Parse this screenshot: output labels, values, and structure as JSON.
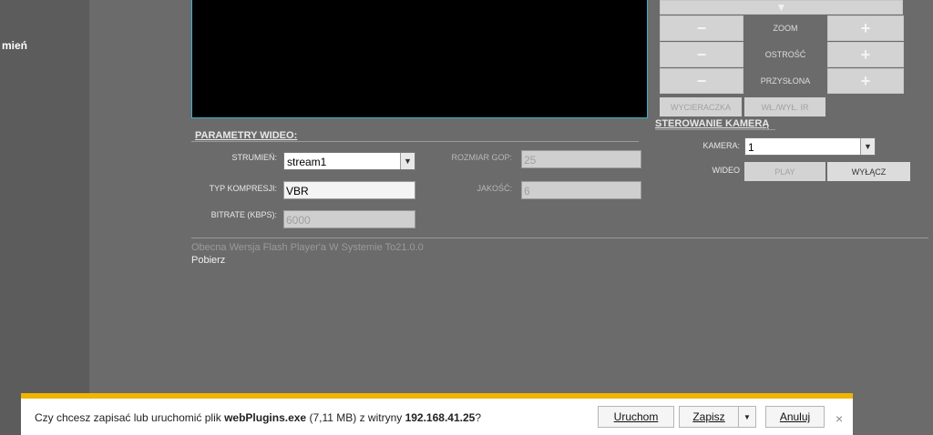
{
  "sidebar": {
    "active_item": "mień"
  },
  "video_params": {
    "title": "PARAMETRY WIDEO:",
    "stream_label": "STRUMIEŃ:",
    "stream_value": "stream1",
    "compression_label": "TYP KOMPRESJI:",
    "compression_value": "VBR",
    "bitrate_label": "BITRATE (KBPS):",
    "bitrate_value": "6000",
    "gop_label": "ROZMIAR GOP:",
    "gop_value": "25",
    "quality_label": "JAKOŚĆ:",
    "quality_value": "6"
  },
  "ptz": {
    "minus": "−",
    "plus": "+",
    "zoom": "ZOOM",
    "focus": "OSTROŚĆ",
    "iris": "PRZYSŁONA",
    "wiper": "WYCIERACZKA",
    "ir_toggle": "WŁ./WYŁ. IR"
  },
  "camera_control": {
    "title": "STEROWANIE KAMERĄ",
    "camera_label": "KAMERA:",
    "camera_value": "1",
    "video_label": "WIDEO",
    "play": "PLAY",
    "off": "WYŁĄCZ"
  },
  "flash": {
    "note": "Obecna Wersja Flash Player'a W Systemie To21.0.0",
    "download": "Pobierz"
  },
  "download_bar": {
    "prefix": "Czy chcesz zapisać lub uruchomić plik ",
    "filename": "webPlugins.exe",
    "size": " (7,11 MB) z witryny ",
    "host": "192.168.41.25",
    "suffix": "?",
    "run": "Uruchom",
    "save": "Zapisz",
    "cancel": "Anuluj",
    "close": "×",
    "dropdown": "▼"
  },
  "colors": {
    "accent": "#f0b400",
    "video_border": "#3ab0c8"
  }
}
